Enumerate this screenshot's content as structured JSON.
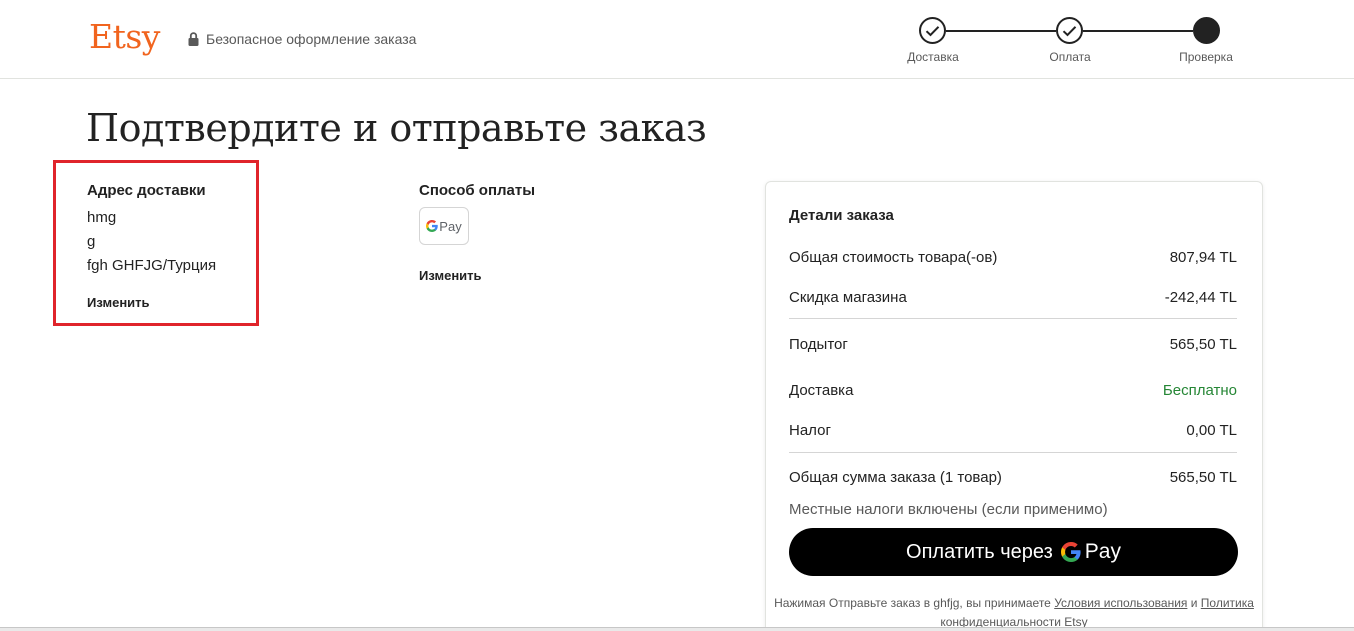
{
  "header": {
    "logo": "Etsy",
    "secure_text": "Безопасное оформление заказа",
    "steps": [
      {
        "label": "Доставка",
        "state": "done"
      },
      {
        "label": "Оплата",
        "state": "done"
      },
      {
        "label": "Проверка",
        "state": "current"
      }
    ]
  },
  "main": {
    "title": "Подтвердите и отправьте заказ",
    "shipping": {
      "title": "Адрес доставки",
      "lines": [
        "hmg",
        "g",
        "fgh GHFJG/Турция"
      ],
      "change_label": "Изменить"
    },
    "payment": {
      "title": "Способ оплаты",
      "method_pay": "Pay",
      "change_label": "Изменить"
    }
  },
  "order": {
    "title": "Детали заказа",
    "rows": [
      {
        "label": "Общая стоимость товара(-ов)",
        "value": "807,94 TL"
      },
      {
        "label": "Скидка магазина",
        "value": "-242,44 TL"
      },
      {
        "label": "Подытог",
        "value": "565,50 TL"
      },
      {
        "label": "Доставка",
        "value": "Бесплатно"
      },
      {
        "label": "Налог",
        "value": "0,00 TL"
      },
      {
        "label": "Общая сумма заказа (1 товар)",
        "value": "565,50 TL"
      }
    ],
    "note": "Местные налоги включены (если применимо)",
    "pay_button_text": "Оплатить через",
    "pay_button_brand": "Pay",
    "legal": {
      "prefix": "Нажимая Отправьте заказ в ghfjg, вы принимаете ",
      "terms_link": "Условия использования",
      "middle": " и ",
      "privacy_link": "Политика конфиденциальности",
      "suffix": " Etsy"
    }
  },
  "colors": {
    "brand": "#f1641e",
    "highlight": "#e0242b",
    "free_shipping": "#258635",
    "button": "#000000"
  }
}
